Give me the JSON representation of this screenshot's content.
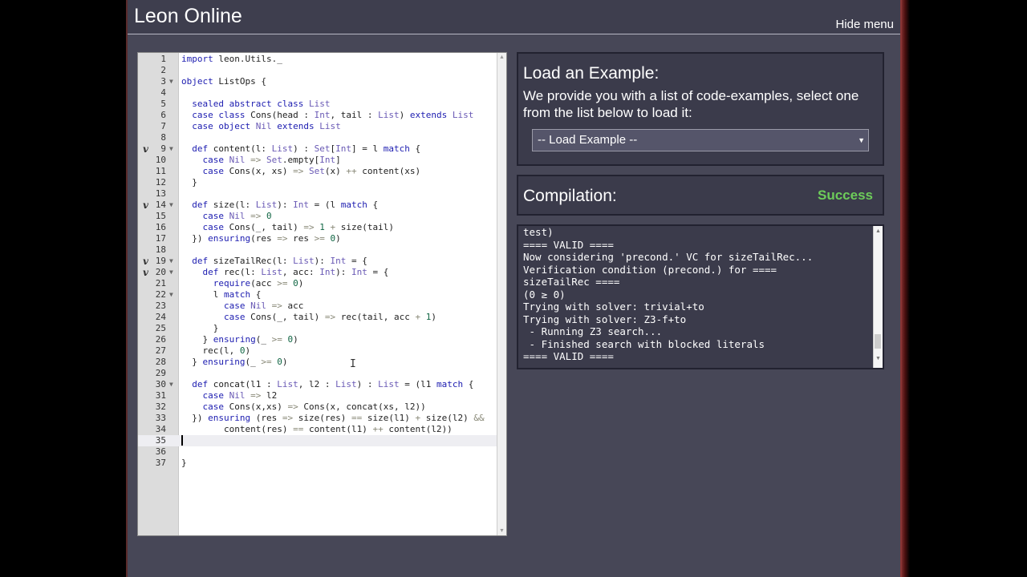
{
  "header": {
    "title": "Leon Online",
    "hide_menu": "Hide menu"
  },
  "editor": {
    "lines": [
      {
        "n": "1",
        "text": "import leon.Utils._",
        "fold": false,
        "mark": ""
      },
      {
        "n": "2",
        "text": "",
        "fold": false,
        "mark": ""
      },
      {
        "n": "3",
        "text": "object ListOps {",
        "fold": true,
        "mark": ""
      },
      {
        "n": "4",
        "text": "",
        "fold": false,
        "mark": ""
      },
      {
        "n": "5",
        "text": "  sealed abstract class List",
        "fold": false,
        "mark": ""
      },
      {
        "n": "6",
        "text": "  case class Cons(head : Int, tail : List) extends List",
        "fold": false,
        "mark": ""
      },
      {
        "n": "7",
        "text": "  case object Nil extends List",
        "fold": false,
        "mark": ""
      },
      {
        "n": "8",
        "text": "",
        "fold": false,
        "mark": ""
      },
      {
        "n": "9",
        "text": "  def content(l: List) : Set[Int] = l match {",
        "fold": true,
        "mark": "V"
      },
      {
        "n": "10",
        "text": "    case Nil => Set.empty[Int]",
        "fold": false,
        "mark": ""
      },
      {
        "n": "11",
        "text": "    case Cons(x, xs) => Set(x) ++ content(xs)",
        "fold": false,
        "mark": ""
      },
      {
        "n": "12",
        "text": "  }",
        "fold": false,
        "mark": ""
      },
      {
        "n": "13",
        "text": "",
        "fold": false,
        "mark": ""
      },
      {
        "n": "14",
        "text": "  def size(l: List): Int = (l match {",
        "fold": true,
        "mark": "V"
      },
      {
        "n": "15",
        "text": "    case Nil => 0",
        "fold": false,
        "mark": ""
      },
      {
        "n": "16",
        "text": "    case Cons(_, tail) => 1 + size(tail)",
        "fold": false,
        "mark": ""
      },
      {
        "n": "17",
        "text": "  }) ensuring(res => res >= 0)",
        "fold": false,
        "mark": ""
      },
      {
        "n": "18",
        "text": "",
        "fold": false,
        "mark": ""
      },
      {
        "n": "19",
        "text": "  def sizeTailRec(l: List): Int = {",
        "fold": true,
        "mark": "V"
      },
      {
        "n": "20",
        "text": "    def rec(l: List, acc: Int): Int = {",
        "fold": true,
        "mark": "V"
      },
      {
        "n": "21",
        "text": "      require(acc >= 0)",
        "fold": false,
        "mark": ""
      },
      {
        "n": "22",
        "text": "      l match {",
        "fold": true,
        "mark": ""
      },
      {
        "n": "23",
        "text": "        case Nil => acc",
        "fold": false,
        "mark": ""
      },
      {
        "n": "24",
        "text": "        case Cons(_, tail) => rec(tail, acc + 1)",
        "fold": false,
        "mark": ""
      },
      {
        "n": "25",
        "text": "      }",
        "fold": false,
        "mark": ""
      },
      {
        "n": "26",
        "text": "    } ensuring(_ >= 0)",
        "fold": false,
        "mark": ""
      },
      {
        "n": "27",
        "text": "    rec(l, 0)",
        "fold": false,
        "mark": ""
      },
      {
        "n": "28",
        "text": "  } ensuring(_ >= 0)",
        "fold": false,
        "mark": ""
      },
      {
        "n": "29",
        "text": "",
        "fold": false,
        "mark": ""
      },
      {
        "n": "30",
        "text": "  def concat(l1 : List, l2 : List) : List = (l1 match {",
        "fold": true,
        "mark": ""
      },
      {
        "n": "31",
        "text": "    case Nil => l2",
        "fold": false,
        "mark": ""
      },
      {
        "n": "32",
        "text": "    case Cons(x,xs) => Cons(x, concat(xs, l2))",
        "fold": false,
        "mark": ""
      },
      {
        "n": "33",
        "text": "  }) ensuring (res => size(res) == size(l1) + size(l2) &&",
        "fold": false,
        "mark": ""
      },
      {
        "n": "34",
        "text": "        content(res) == content(l1) ++ content(l2))",
        "fold": false,
        "mark": ""
      },
      {
        "n": "35",
        "text": "",
        "fold": false,
        "mark": "",
        "active": true
      },
      {
        "n": "36",
        "text": "",
        "fold": false,
        "mark": ""
      },
      {
        "n": "37",
        "text": "}",
        "fold": false,
        "mark": ""
      }
    ]
  },
  "load_panel": {
    "title": "Load an Example:",
    "description": "We provide you with a list of code-examples, select one from the list below to load it:",
    "select_value": "-- Load Example --"
  },
  "compilation": {
    "label": "Compilation:",
    "status": "Success",
    "status_color": "#6dcc5a"
  },
  "console": {
    "lines": [
      "test)",
      "==== VALID ====",
      "Now considering 'precond.' VC for sizeTailRec...",
      "Verification condition (precond.) for ====",
      "sizeTailRec ====",
      "(0 ≥ 0)",
      "Trying with solver: trivial+to",
      "Trying with solver: Z3-f+to",
      " - Running Z3 search...",
      " - Finished search with blocked literals",
      "==== VALID ===="
    ]
  },
  "icons": {
    "fold": "triangle-down-icon",
    "verified": "v-mark-icon",
    "scroll_up": "arrow-up-icon",
    "scroll_down": "arrow-down-icon"
  }
}
